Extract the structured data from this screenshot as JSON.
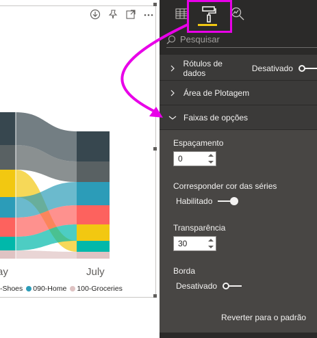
{
  "chart_data": {
    "type": "ribbon",
    "categories": [
      "May",
      "July"
    ],
    "legend": [
      {
        "name": "...-Shoes",
        "color": "#2c9cb8"
      },
      {
        "name": "090-Home",
        "color": "#2c9cb8"
      },
      {
        "name": "100-Groceries",
        "color": "#dfc3c3"
      }
    ],
    "ribbon_colors": [
      "#37474f",
      "#596163",
      "#f2c811",
      "#2c9cb8",
      "#fd625e",
      "#01b8aa",
      "#dfc3c3"
    ]
  },
  "visual": {
    "month_1": "ay",
    "month_2": "July",
    "legend_items": [
      "-Shoes",
      "090-Home",
      "100-Groceries"
    ],
    "header_icons": [
      "download-icon",
      "pin-icon",
      "focus-mode-icon",
      "more-options-icon"
    ]
  },
  "pane": {
    "tabs": [
      "fields-tab",
      "format-tab",
      "analytics-tab"
    ],
    "search_placeholder": "Pesquisar",
    "sections": {
      "data_labels": {
        "label": "Rótulos de dados",
        "state": "Desativado"
      },
      "plot_area": {
        "label": "Área de Plotagem"
      },
      "ribbons": {
        "label": "Faixas de opções"
      }
    },
    "spacing": {
      "label": "Espaçamento",
      "value": "0"
    },
    "match_series": {
      "label": "Corresponder cor das séries",
      "state": "Habilitado"
    },
    "transparency": {
      "label": "Transparência",
      "value": "30"
    },
    "border": {
      "label": "Borda",
      "state": "Desativado"
    },
    "reset_label": "Reverter para o padrão"
  },
  "colors": {
    "pane_bg": "#3b3a39",
    "accent": "#f2c811",
    "highlight": "#e800e8"
  }
}
